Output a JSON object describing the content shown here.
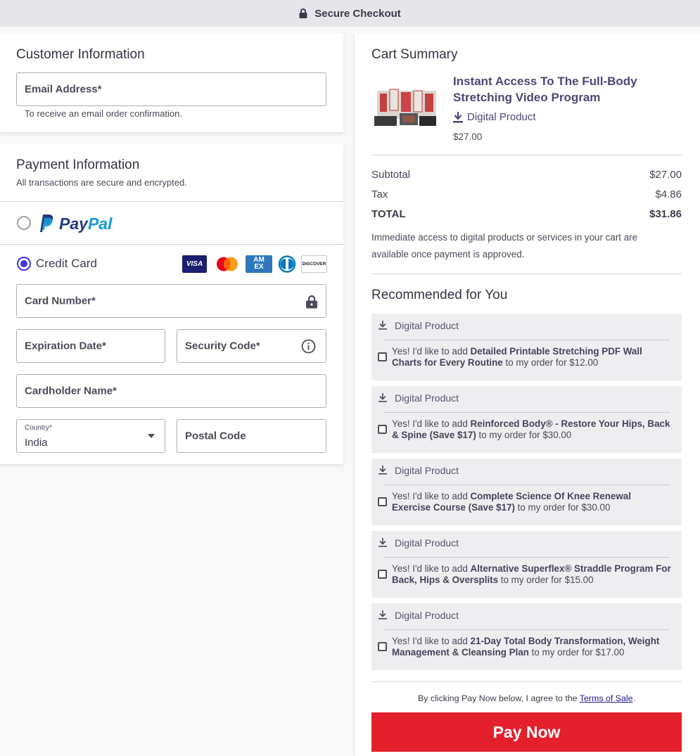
{
  "topbar": {
    "title": "Secure Checkout"
  },
  "customer": {
    "heading": "Customer Information",
    "email_label": "Email Address*",
    "email_help": "To receive an email order confirmation."
  },
  "payment": {
    "heading": "Payment Information",
    "subheading": "All transactions are secure and encrypted.",
    "paypal_label_pay": "Pay",
    "paypal_label_pal": "Pal",
    "credit_card_label": "Credit Card",
    "card_brands": {
      "visa": "VISA",
      "amex_1": "AM",
      "amex_2": "EX",
      "discover": "DISCOVER"
    },
    "selected_method": "Credit Card",
    "card_number_label": "Card Number*",
    "expiration_label": "Expiration Date*",
    "security_code_label": "Security Code*",
    "cardholder_label": "Cardholder Name*",
    "country_label": "Country*",
    "country_value": "India",
    "postal_label": "Postal Code"
  },
  "cart": {
    "heading": "Cart Summary",
    "product_title": "Instant Access To The Full-Body Stretching Video Program",
    "product_type": "Digital Product",
    "product_price": "$27.00",
    "subtotal_label": "Subtotal",
    "subtotal_value": "$27.00",
    "tax_label": "Tax",
    "tax_value": "$4.86",
    "total_label": "TOTAL",
    "total_value": "$31.86",
    "access_note": "Immediate access to digital products or services in your cart are available once payment is approved.",
    "recommended_heading": "Recommended for You",
    "recommendations": [
      {
        "tag": "Digital Product",
        "prefix": "Yes! I'd like to add ",
        "name": "Detailed Printable Stretching PDF Wall Charts for Every Routine",
        "suffix": " to my order for $12.00"
      },
      {
        "tag": "Digital Product",
        "prefix": "Yes! I'd like to add ",
        "name": "Reinforced Body® - Restore Your Hips, Back & Spine (Save $17)",
        "suffix": " to my order for $30.00"
      },
      {
        "tag": "Digital Product",
        "prefix": "Yes! I'd like to add ",
        "name": "Complete Science Of Knee Renewal Exercise Course (Save $17)",
        "suffix": " to my order for $30.00"
      },
      {
        "tag": "Digital Product",
        "prefix": "Yes! I'd like to add ",
        "name": "Alternative Superflex® Straddle Program For Back, Hips & Oversplits",
        "suffix": " to my order for $15.00"
      },
      {
        "tag": "Digital Product",
        "prefix": "Yes! I'd like to add ",
        "name": "21-Day Total Body Transformation, Weight Management & Cleansing Plan",
        "suffix": " to my order for $17.00"
      }
    ],
    "agree_text": "By clicking Pay Now below, I agree to the ",
    "terms_link": "Terms of Sale",
    "agree_end": ".",
    "pay_button": "Pay Now"
  },
  "colors": {
    "accent": "#4033e0",
    "pay_button": "#e3202c",
    "paypal_dark": "#253b80",
    "paypal_light": "#179bd7"
  }
}
